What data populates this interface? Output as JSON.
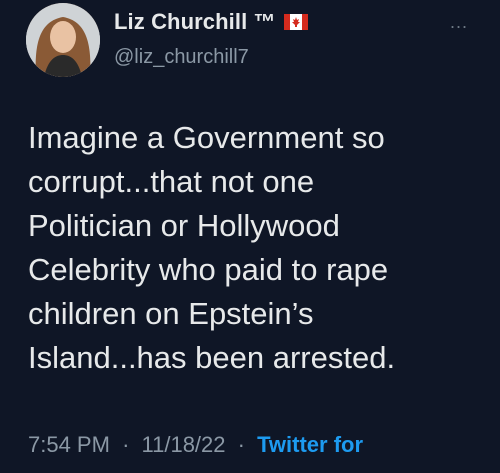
{
  "tweet": {
    "author_name": "Liz Churchill ™",
    "author_handle": "@liz_churchill7",
    "flag_icon": "canada-flag-icon",
    "more_label": "...",
    "text": "Imagine a Government so\ncorrupt...that not one\nPolitician or Hollywood\nCelebrity who paid to rape\nchildren on Epstein’s\nIsland...has been arrested.",
    "time": "7:54 PM",
    "date": "11/18/22",
    "source": "Twitter for",
    "separator": "·"
  },
  "colors": {
    "background": "#0f1626",
    "text": "#e7e9ea",
    "muted": "#8b98a5",
    "accent": "#1d9bf0"
  }
}
